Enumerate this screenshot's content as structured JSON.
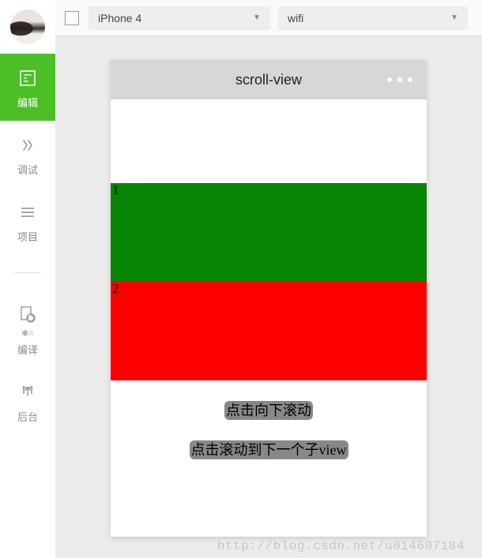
{
  "sidebar": {
    "items": [
      {
        "label": "编辑"
      },
      {
        "label": "调试"
      },
      {
        "label": "项目"
      },
      {
        "label": "编译"
      },
      {
        "label": "后台"
      }
    ]
  },
  "topbar": {
    "device": "iPhone 4",
    "network": "wifi"
  },
  "phone": {
    "title": "scroll-view",
    "block1": "1",
    "block2": "2",
    "button1": "点击向下滚动",
    "button2": "点击滚动到下一个子view"
  },
  "watermark": "http://blog.csdn.net/u014607184"
}
